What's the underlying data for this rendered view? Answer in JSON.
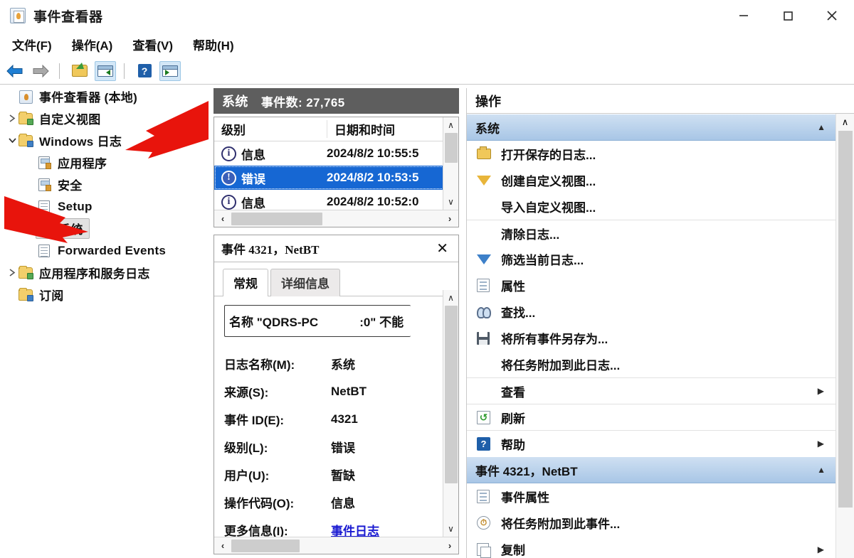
{
  "window": {
    "title": "事件查看器",
    "icon": "event-viewer-icon",
    "minimize": "–",
    "maximize": "□",
    "close": "×"
  },
  "menu": [
    {
      "label": "文件(F)",
      "name": "menu-file"
    },
    {
      "label": "操作(A)",
      "name": "menu-action"
    },
    {
      "label": "查看(V)",
      "name": "menu-view"
    },
    {
      "label": "帮助(H)",
      "name": "menu-help"
    }
  ],
  "toolbar": [
    {
      "name": "back-button",
      "icon": "back-arrow-icon",
      "pressed": false
    },
    {
      "name": "forward-button",
      "icon": "forward-arrow-icon",
      "pressed": false
    },
    {
      "name": "up-folder-button",
      "icon": "folder-up-icon",
      "pressed": false
    },
    {
      "name": "show-tree-pane-button",
      "icon": "tree-pane-icon",
      "pressed": true
    },
    {
      "name": "help-button",
      "icon": "help-icon",
      "pressed": false
    },
    {
      "name": "show-action-pane-button",
      "icon": "action-pane-icon",
      "pressed": true
    }
  ],
  "tree": {
    "root": {
      "label": "事件查看器 (本地)",
      "icon": "event-viewer-icon"
    },
    "items": [
      {
        "label": "自定义视图",
        "icon": "folder-icon",
        "twisty": "collapsed",
        "level": 1
      },
      {
        "label": "Windows 日志",
        "icon": "folder-icon",
        "twisty": "expanded",
        "level": 1
      },
      {
        "label": "应用程序",
        "icon": "app-log-icon",
        "twisty": "none",
        "level": 2
      },
      {
        "label": "安全",
        "icon": "security-log-icon",
        "twisty": "none",
        "level": 2
      },
      {
        "label": "Setup",
        "icon": "log-icon",
        "twisty": "none",
        "level": 2
      },
      {
        "label": "系统",
        "icon": "system-log-icon",
        "twisty": "none",
        "level": 2,
        "selected": true
      },
      {
        "label": "Forwarded Events",
        "icon": "log-icon",
        "twisty": "none",
        "level": 2
      },
      {
        "label": "应用程序和服务日志",
        "icon": "folder-icon",
        "twisty": "collapsed",
        "level": 1
      },
      {
        "label": "订阅",
        "icon": "folder-icon",
        "twisty": "none",
        "level": 1
      }
    ]
  },
  "list": {
    "header_title": "系统",
    "header_count": "事件数: 27,765",
    "columns": [
      "级别",
      "日期和时间"
    ],
    "rows": [
      {
        "level": "信息",
        "icon": "info-icon",
        "date": "2024/8/2 10:55:5",
        "selected": false
      },
      {
        "level": "错误",
        "icon": "error-icon",
        "date": "2024/8/2 10:53:5",
        "selected": true
      },
      {
        "level": "信息",
        "icon": "info-icon",
        "date": "2024/8/2 10:52:0",
        "selected": false
      }
    ],
    "scroll_up": "∧",
    "scroll_down": "∨",
    "scroll_left": "‹",
    "scroll_right": "›"
  },
  "detail": {
    "title": "事件 4321，NetBT",
    "close": "✕",
    "tabs": [
      {
        "label": "常规",
        "active": true
      },
      {
        "label": "详细信息",
        "active": false
      }
    ],
    "description_prefix": "名称 \"QDRS-PC",
    "description_suffix": ":0\" 不能",
    "fields": [
      {
        "key": "日志名称(M):",
        "key_mnemonic": "M",
        "value": "系统",
        "link": false
      },
      {
        "key": "来源(S):",
        "key_mnemonic": "S",
        "value": "NetBT",
        "link": false
      },
      {
        "key": "事件 ID(E):",
        "key_mnemonic": "E",
        "value": "4321",
        "link": false
      },
      {
        "key": "级别(L):",
        "key_mnemonic": "L",
        "value": "错误",
        "link": false
      },
      {
        "key": "用户(U):",
        "key_mnemonic": "U",
        "value": "暂缺",
        "link": false
      },
      {
        "key": "操作代码(O):",
        "key_mnemonic": "O",
        "value": "信息",
        "link": false
      },
      {
        "key": "更多信息(I):",
        "key_mnemonic": "I",
        "value": "事件日志",
        "link": true
      }
    ],
    "scroll_up": "∧",
    "scroll_down": "∨",
    "scroll_left": "‹",
    "scroll_right": "›"
  },
  "actions": {
    "header": "操作",
    "sections": [
      {
        "title": "系统",
        "collapse_chevron": "▲",
        "items": [
          {
            "label": "打开保存的日志...",
            "icon": "open-saved-log-icon",
            "submenu": false,
            "divider": false
          },
          {
            "label": "创建自定义视图...",
            "icon": "create-custom-view-icon",
            "submenu": false,
            "divider": false
          },
          {
            "label": "导入自定义视图...",
            "icon": "none",
            "submenu": false,
            "divider": false
          },
          {
            "label": "清除日志...",
            "icon": "none",
            "submenu": false,
            "divider": true
          },
          {
            "label": "筛选当前日志...",
            "icon": "filter-icon",
            "submenu": false,
            "divider": false
          },
          {
            "label": "属性",
            "icon": "properties-icon",
            "submenu": false,
            "divider": false
          },
          {
            "label": "查找...",
            "icon": "find-icon",
            "submenu": false,
            "divider": false
          },
          {
            "label": "将所有事件另存为...",
            "icon": "save-icon",
            "submenu": false,
            "divider": false
          },
          {
            "label": "将任务附加到此日志...",
            "icon": "none",
            "submenu": false,
            "divider": false
          },
          {
            "label": "查看",
            "icon": "none",
            "submenu": true,
            "divider": true
          },
          {
            "label": "刷新",
            "icon": "refresh-icon",
            "submenu": false,
            "divider": true
          },
          {
            "label": "帮助",
            "icon": "help-icon",
            "submenu": true,
            "divider": true
          }
        ]
      },
      {
        "title": "事件 4321，NetBT",
        "collapse_chevron": "▲",
        "items": [
          {
            "label": "事件属性",
            "icon": "properties-icon",
            "submenu": false,
            "divider": false
          },
          {
            "label": "将任务附加到此事件...",
            "icon": "attach-task-icon",
            "submenu": false,
            "divider": false
          },
          {
            "label": "复制",
            "icon": "copy-icon",
            "submenu": true,
            "divider": false
          }
        ]
      }
    ],
    "scroll_up": "∧"
  },
  "annotations": [
    {
      "name": "arrow-pointing-windows-logs",
      "color": "#e8140c",
      "target": "Windows 日志"
    },
    {
      "name": "arrow-pointing-system-log",
      "color": "#e8140c",
      "target": "系统"
    }
  ]
}
